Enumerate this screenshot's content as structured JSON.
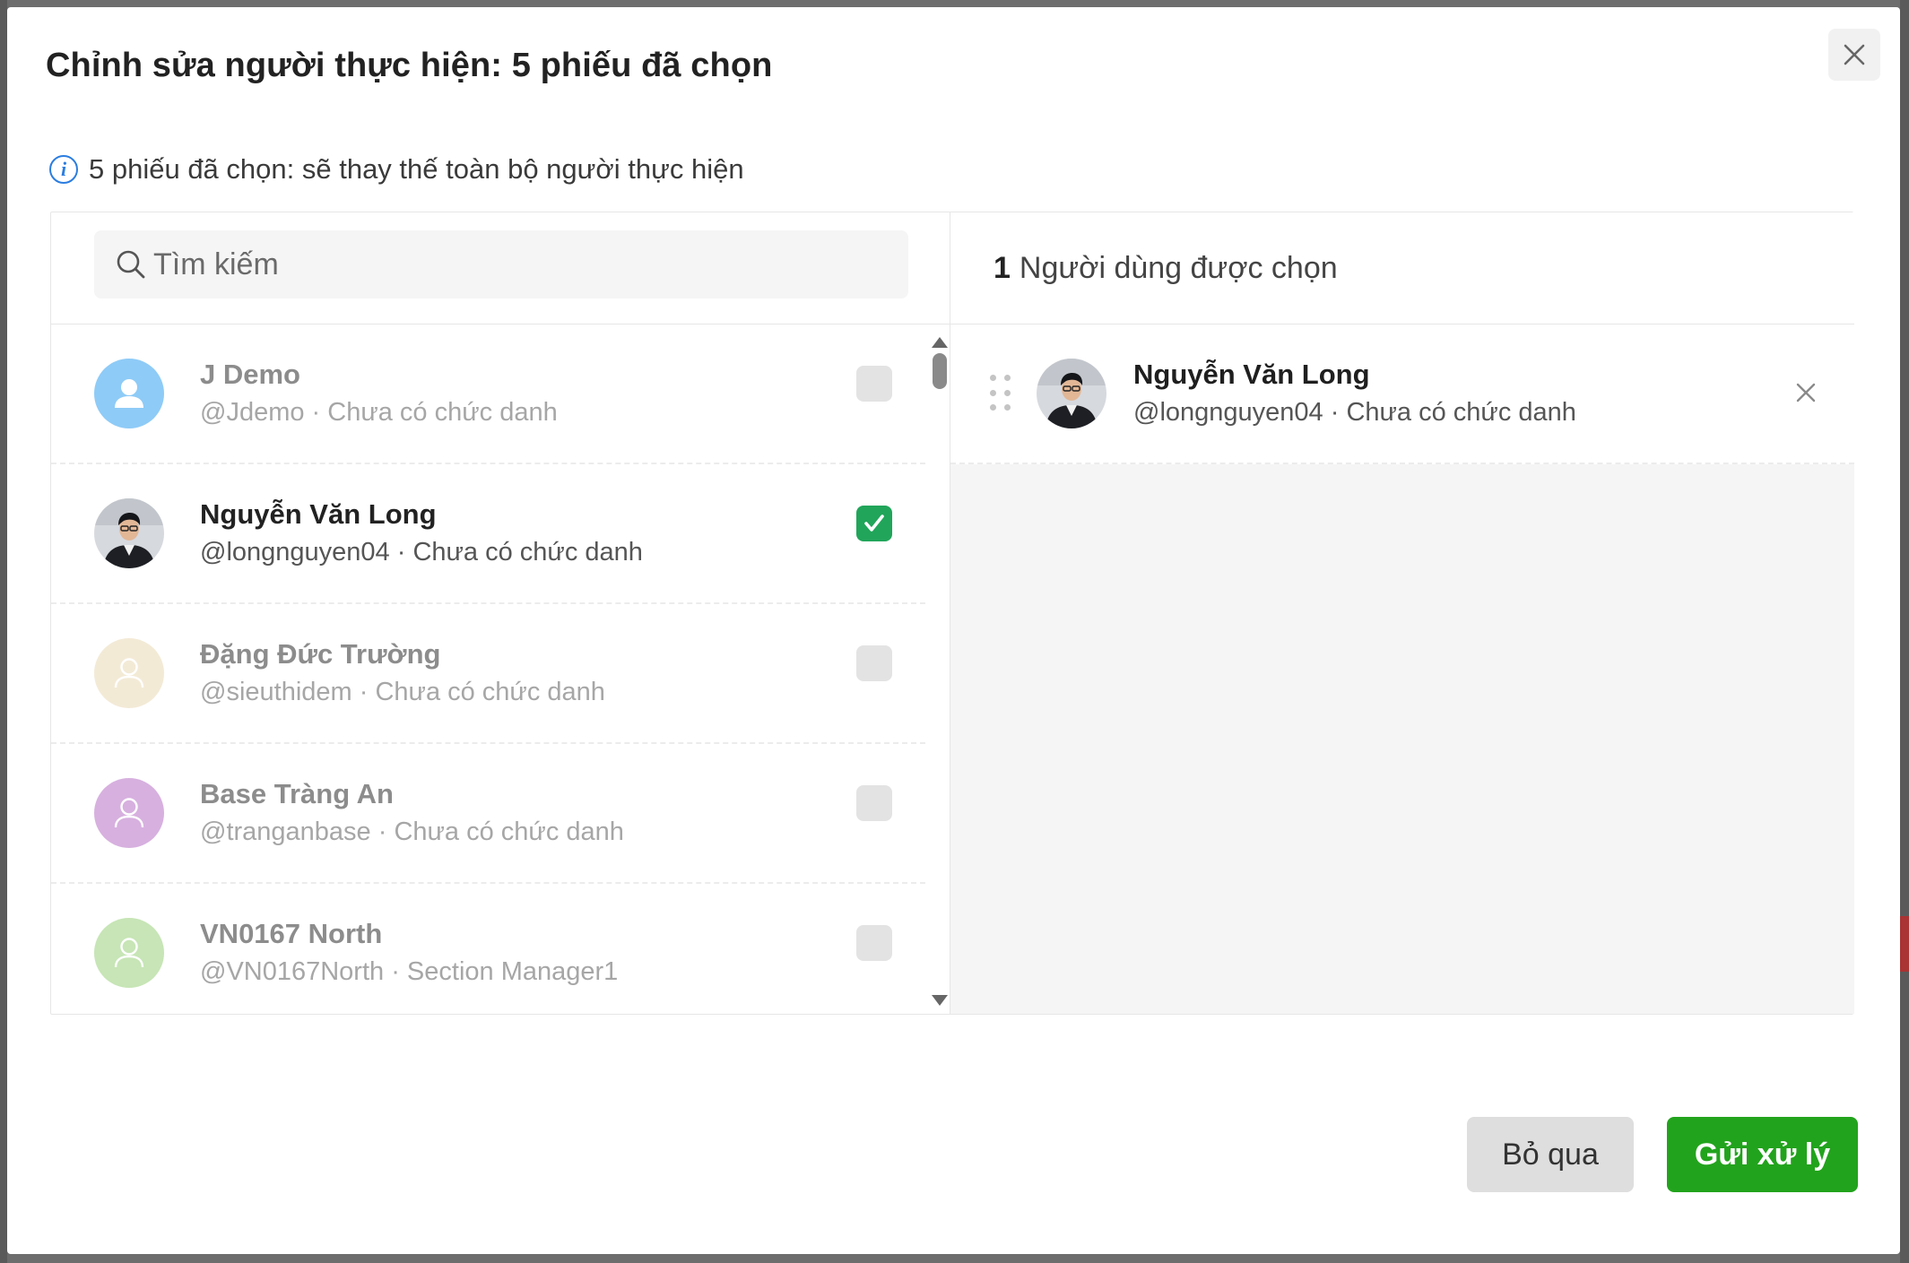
{
  "modal": {
    "title": "Chỉnh sửa người thực hiện: 5 phiếu đã chọn",
    "info": "5 phiếu đã chọn: sẽ thay thế toàn bộ người thực hiện",
    "info_icon_glyph": "i"
  },
  "search": {
    "placeholder": "Tìm kiếm",
    "value": ""
  },
  "users": [
    {
      "name": "J Demo",
      "subtitle": "@Jdemo · Chưa có chức danh",
      "checked": false,
      "avatar": "person-icon",
      "avatar_color": "#8ecbf7"
    },
    {
      "name": "Nguyễn Văn Long",
      "subtitle": "@longnguyen04 · Chưa có chức danh",
      "checked": true,
      "avatar": "photo"
    },
    {
      "name": "Đặng Đức Trường",
      "subtitle": "@sieuthidem · Chưa có chức danh",
      "checked": false,
      "avatar": "person-icon",
      "avatar_color": "#f3ead6"
    },
    {
      "name": "Base Tràng An",
      "subtitle": "@tranganbase · Chưa có chức danh",
      "checked": false,
      "avatar": "person-icon",
      "avatar_color": "#d7b0df"
    },
    {
      "name": "VN0167 North",
      "subtitle": "@VN0167North · Section Manager1",
      "checked": false,
      "avatar": "person-icon",
      "avatar_color": "#c7e5b6"
    }
  ],
  "selected": {
    "count": "1",
    "label": "Người dùng được chọn",
    "items": [
      {
        "name": "Nguyễn Văn Long",
        "subtitle": "@longnguyen04 · Chưa có chức danh"
      }
    ]
  },
  "footer": {
    "cancel_label": "Bỏ qua",
    "submit_label": "Gửi xử lý"
  },
  "colors": {
    "accent_green": "#22a31d",
    "check_green": "#21a55a",
    "info_blue": "#2b7de0"
  }
}
